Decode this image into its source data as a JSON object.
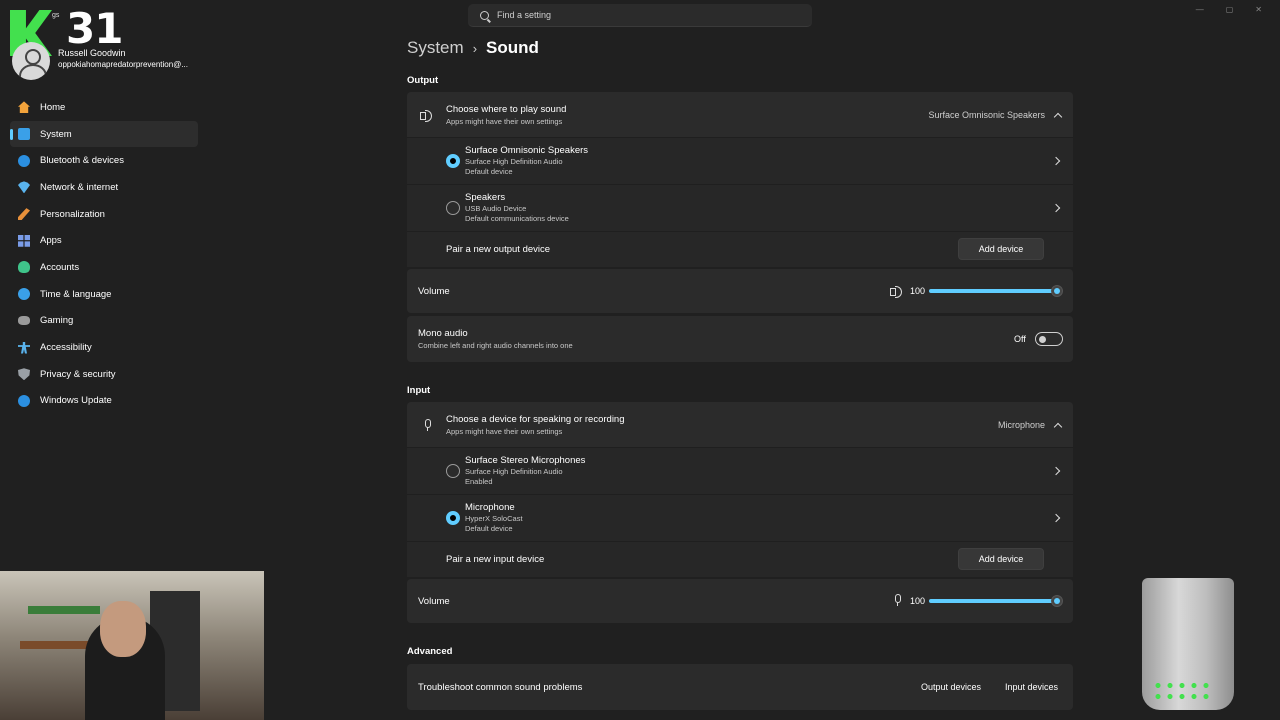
{
  "overlay": {
    "logo_small_text": "gs",
    "big_number": "31",
    "user_name": "Russell Goodwin",
    "user_email": "oppokiahomapredatorprevention@..."
  },
  "search": {
    "placeholder": "Find a setting"
  },
  "window_controls": {
    "minimize": "—",
    "maximize": "▢",
    "close": "✕"
  },
  "sidebar": {
    "items": [
      {
        "label": "Home",
        "icon": "home-icon"
      },
      {
        "label": "System",
        "icon": "system-icon",
        "active": true
      },
      {
        "label": "Bluetooth & devices",
        "icon": "bluetooth-icon"
      },
      {
        "label": "Network & internet",
        "icon": "network-icon"
      },
      {
        "label": "Personalization",
        "icon": "brush-icon"
      },
      {
        "label": "Apps",
        "icon": "apps-icon"
      },
      {
        "label": "Accounts",
        "icon": "accounts-icon"
      },
      {
        "label": "Time & language",
        "icon": "globe-icon"
      },
      {
        "label": "Gaming",
        "icon": "gamepad-icon"
      },
      {
        "label": "Accessibility",
        "icon": "accessibility-icon"
      },
      {
        "label": "Privacy & security",
        "icon": "shield-icon"
      },
      {
        "label": "Windows Update",
        "icon": "update-icon"
      }
    ]
  },
  "breadcrumb": {
    "parent": "System",
    "separator": "›",
    "current": "Sound"
  },
  "output": {
    "section_title": "Output",
    "choose": {
      "title": "Choose where to play sound",
      "subtitle": "Apps might have their own settings",
      "selected": "Surface Omnisonic Speakers"
    },
    "devices": [
      {
        "name": "Surface Omnisonic Speakers",
        "driver": "Surface High Definition Audio",
        "status": "Default device",
        "selected": true
      },
      {
        "name": "Speakers",
        "driver": "USB Audio Device",
        "status": "Default communications device",
        "selected": false
      }
    ],
    "pair": {
      "label": "Pair a new output device",
      "button": "Add device"
    },
    "volume": {
      "label": "Volume",
      "value": "100",
      "level_percent": 100
    },
    "mono": {
      "title": "Mono audio",
      "subtitle": "Combine left and right audio channels into one",
      "state": "Off"
    }
  },
  "input": {
    "section_title": "Input",
    "choose": {
      "title": "Choose a device for speaking or recording",
      "subtitle": "Apps might have their own settings",
      "selected": "Microphone"
    },
    "devices": [
      {
        "name": "Surface Stereo Microphones",
        "driver": "Surface High Definition Audio",
        "status": "Enabled",
        "selected": false
      },
      {
        "name": "Microphone",
        "driver": "HyperX SoloCast",
        "status": "Default device",
        "selected": true
      }
    ],
    "pair": {
      "label": "Pair a new input device",
      "button": "Add device"
    },
    "volume": {
      "label": "Volume",
      "value": "100",
      "level_percent": 100
    }
  },
  "advanced": {
    "section_title": "Advanced",
    "troubleshoot": {
      "label": "Troubleshoot common sound problems",
      "output_link": "Output devices",
      "input_link": "Input devices"
    }
  },
  "colors": {
    "accent": "#60cdff",
    "background": "#202020",
    "card": "#2b2b2b",
    "logo_green": "#43e04e"
  }
}
